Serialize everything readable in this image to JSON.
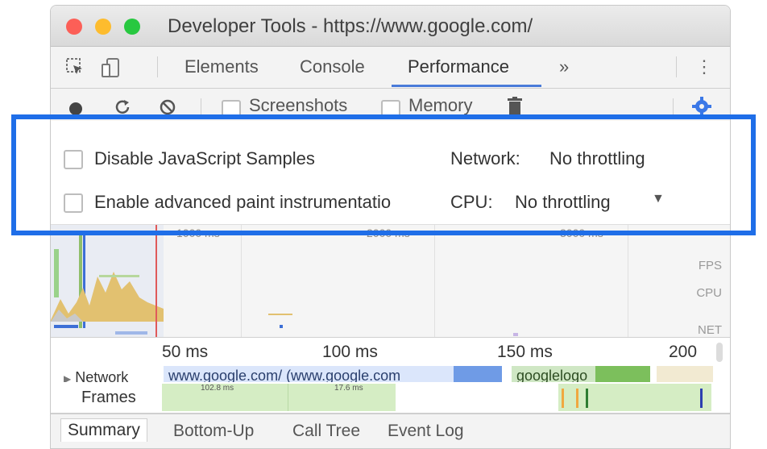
{
  "window": {
    "title": "Developer Tools - https://www.google.com/"
  },
  "tabs": [
    {
      "label": "Elements"
    },
    {
      "label": "Console"
    },
    {
      "label": "Performance"
    },
    {
      "label": "»"
    }
  ],
  "toolbar": {
    "screenshots_label": "Screenshots",
    "memory_label": "Memory"
  },
  "capture_settings": {
    "disable_js_samples_label": "Disable JavaScript Samples",
    "disable_js_samples_checked": false,
    "advanced_paint_label": "Enable advanced paint instrumentatio",
    "advanced_paint_checked": false,
    "network_label": "Network:",
    "network_value": "No throttling",
    "cpu_label": "CPU:",
    "cpu_value": "No throttling"
  },
  "overview": {
    "ticks": [
      "1000 ms",
      "2000 ms",
      "3000 ms"
    ],
    "labels": {
      "fps": "FPS",
      "cpu": "CPU",
      "net": "NET"
    }
  },
  "ruler": {
    "ticks": [
      "50 ms",
      "100 ms",
      "150 ms",
      "200"
    ]
  },
  "tracks": {
    "network_label": "Network",
    "network_text": "www.google.com/ (www.google.com",
    "network_text_2": "googlelogo",
    "frames_label": "Frames",
    "frame_time_1": "102.8 ms",
    "frame_time_2": "17.6 ms"
  },
  "bottom_tabs": [
    {
      "label": "Summary"
    },
    {
      "label": "Bottom-Up"
    },
    {
      "label": "Call Tree"
    },
    {
      "label": "Event Log"
    }
  ],
  "colors": {
    "highlight": "#1f6ee8",
    "accent": "#4a7bd9"
  }
}
